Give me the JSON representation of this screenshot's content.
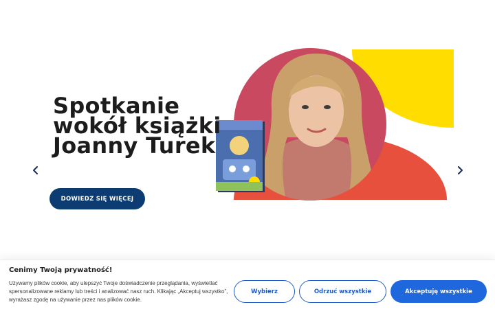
{
  "hero": {
    "title_lines": [
      "Spotkanie",
      "wokół książki",
      "Joanny Turek"
    ],
    "cta_label": "DOWIEDZ SIĘ WIĘCEJ",
    "prev_icon": "chevron-left-icon",
    "next_icon": "chevron-right-icon"
  },
  "artwork": {
    "circle_color": "#c94a60",
    "semicircle_color": "#e8503e",
    "quarter_color": "#ffdd00",
    "book_cover_color": "#4b6fae"
  },
  "cookie_banner": {
    "title": "Cenimy Twoją prywatność!",
    "text": "Używamy plików cookie, aby ulepszyć Twoje doświadczenie przeglądania, wyświetlać spersonalizowane reklamy lub treści i analizować nasz ruch. Klikając „Akceptuj wszystko”, wyrażasz zgodę na używanie przez nas plików cookie.",
    "buttons": {
      "choose": "Wybierz",
      "reject": "Odrzuć wszystkie",
      "accept": "Akceptuję wszystkie"
    }
  },
  "colors": {
    "cta": "#0c3c72",
    "accent_blue": "#1f67dc"
  }
}
